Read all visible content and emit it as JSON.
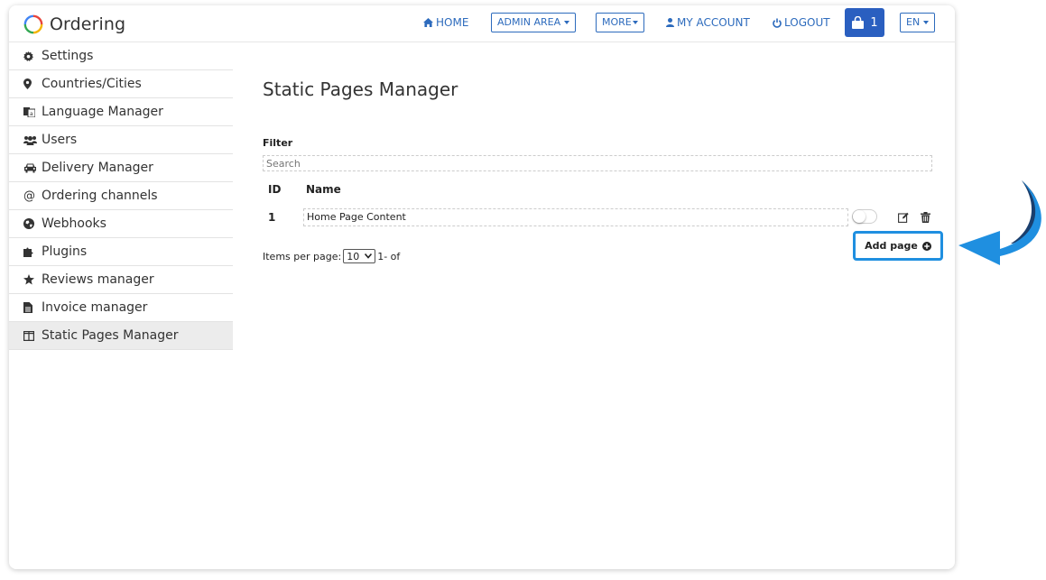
{
  "brand": {
    "name": "Ordering"
  },
  "nav": {
    "home": "HOME",
    "admin_area": "ADMIN AREA",
    "more": "MORE",
    "my_account": "MY ACCOUNT",
    "logout": "LOGOUT",
    "cart_count": "1",
    "language": "EN"
  },
  "sidebar": {
    "items": [
      {
        "label": "Settings",
        "icon": "gear-icon"
      },
      {
        "label": "Countries/Cities",
        "icon": "map-marker-icon"
      },
      {
        "label": "Language Manager",
        "icon": "language-icon"
      },
      {
        "label": "Users",
        "icon": "users-icon"
      },
      {
        "label": "Delivery Manager",
        "icon": "car-icon"
      },
      {
        "label": "Ordering channels",
        "icon": "at-icon"
      },
      {
        "label": "Webhooks",
        "icon": "globe-icon"
      },
      {
        "label": "Plugins",
        "icon": "puzzle-icon"
      },
      {
        "label": "Reviews manager",
        "icon": "star-icon"
      },
      {
        "label": "Invoice manager",
        "icon": "file-icon"
      },
      {
        "label": "Static Pages Manager",
        "icon": "columns-icon"
      }
    ],
    "active_index": 10
  },
  "main": {
    "title": "Static Pages Manager",
    "filter_label": "Filter",
    "search_placeholder": "Search",
    "table": {
      "headers": {
        "id": "ID",
        "name": "Name"
      },
      "rows": [
        {
          "id": "1",
          "name": "Home Page Content",
          "enabled": false
        }
      ]
    },
    "add_page_label": "Add page",
    "items_per_page_label": "Items per page:",
    "items_per_page_value": "10",
    "pagination_text": "1- of"
  },
  "colors": {
    "nav_blue": "#2d6bbd",
    "cart_blue": "#2a5fc0",
    "highlight_blue": "#1f8fe0",
    "arrow_blue": "#1f8fe0"
  }
}
